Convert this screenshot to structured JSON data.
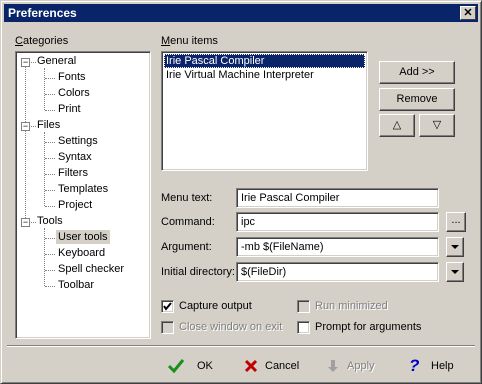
{
  "window": {
    "title": "Preferences",
    "close_glyph": "✕"
  },
  "categories": {
    "label": "Categories",
    "tree": [
      {
        "label": "General",
        "children": [
          "Fonts",
          "Colors",
          "Print"
        ]
      },
      {
        "label": "Files",
        "children": [
          "Settings",
          "Syntax",
          "Filters",
          "Templates",
          "Project"
        ]
      },
      {
        "label": "Tools",
        "children": [
          "User tools",
          "Keyboard",
          "Spell checker",
          "Toolbar"
        ]
      }
    ],
    "selected": "User tools"
  },
  "menu_items": {
    "label": "Menu items",
    "items": [
      "Irie Pascal Compiler",
      "Irie Virtual Machine Interpreter"
    ],
    "selected_index": 0
  },
  "side_buttons": {
    "add": "Add >>",
    "remove": "Remove",
    "up": "△",
    "down": "▽"
  },
  "fields": {
    "menu_text": {
      "label": "Menu text:",
      "value": "Irie Pascal Compiler"
    },
    "command": {
      "label": "Command:",
      "value": "ipc",
      "browse": "..."
    },
    "argument": {
      "label": "Argument:",
      "value": "-mb $(FileName)"
    },
    "initial_directory": {
      "label": "Initial directory:",
      "value": "$(FileDir)"
    }
  },
  "options": {
    "capture_output": {
      "label": "Capture output",
      "checked": true
    },
    "run_minimized": {
      "label": "Run minimized",
      "checked": false,
      "disabled": true
    },
    "close_window_on_exit": {
      "label": "Close window on exit",
      "checked": false,
      "disabled": true
    },
    "prompt_for_arguments": {
      "label": "Prompt for arguments",
      "checked": false
    }
  },
  "footer": {
    "ok": "OK",
    "cancel": "Cancel",
    "apply": "Apply",
    "help": "Help"
  },
  "colors": {
    "title_bg": "#0a246a",
    "face": "#d4d0c8",
    "selection": "#0a246a",
    "ok_green": "#1a8f1a",
    "cancel_red": "#c00000",
    "help_blue": "#0000c0"
  }
}
